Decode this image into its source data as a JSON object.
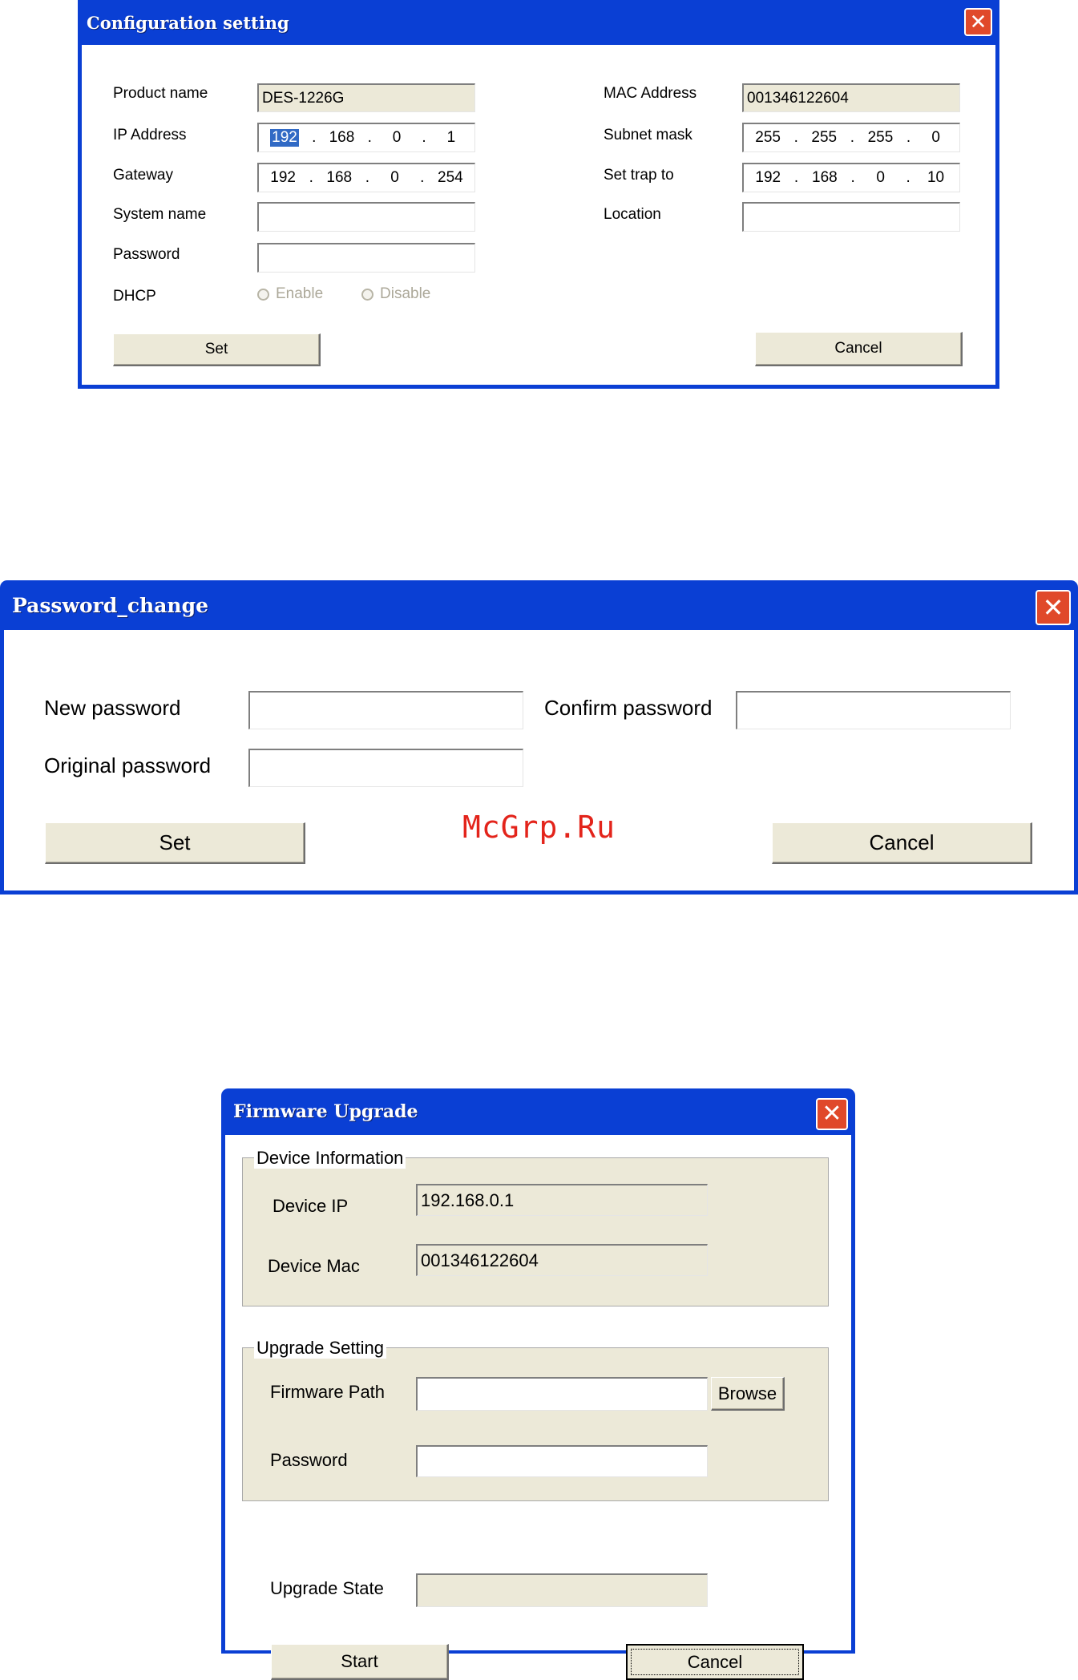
{
  "config": {
    "title": "Configuration setting",
    "close": "✕",
    "labels": {
      "product_name": "Product name",
      "ip_address": "IP Address",
      "gateway": "Gateway",
      "system_name": "System name",
      "password": "Password",
      "dhcp": "DHCP",
      "mac_address": "MAC Address",
      "subnet_mask": "Subnet mask",
      "set_trap_to": "Set trap to",
      "location": "Location"
    },
    "values": {
      "product_name": "DES-1226G",
      "mac_address": "001346122604",
      "system_name": "",
      "password": "",
      "location": ""
    },
    "ip": [
      "192",
      "168",
      "0",
      "1"
    ],
    "gateway": [
      "192",
      "168",
      "0",
      "254"
    ],
    "subnet": [
      "255",
      "255",
      "255",
      "0"
    ],
    "trap": [
      "192",
      "168",
      "0",
      "10"
    ],
    "dot": ".",
    "dhcp_enable": "Enable",
    "dhcp_disable": "Disable",
    "set_label": "Set",
    "cancel_label": "Cancel"
  },
  "password_change": {
    "title": "Password_change",
    "close": "✕",
    "new_password_label": "New password",
    "confirm_password_label": "Confirm password",
    "original_password_label": "Original password",
    "set_label": "Set",
    "cancel_label": "Cancel"
  },
  "watermark": "McGrp.Ru",
  "firmware": {
    "title": "Firmware Upgrade",
    "close": "✕",
    "device_info_legend": "Device Information",
    "device_ip_label": "Device IP",
    "device_ip_value": "192.168.0.1",
    "device_mac_label": "Device Mac",
    "device_mac_value": "001346122604",
    "upgrade_setting_legend": "Upgrade Setting",
    "firmware_path_label": "Firmware Path",
    "browse_label": "Browse",
    "password_label": "Password",
    "upgrade_state_label": "Upgrade State",
    "start_label": "Start",
    "cancel_label": "Cancel"
  }
}
